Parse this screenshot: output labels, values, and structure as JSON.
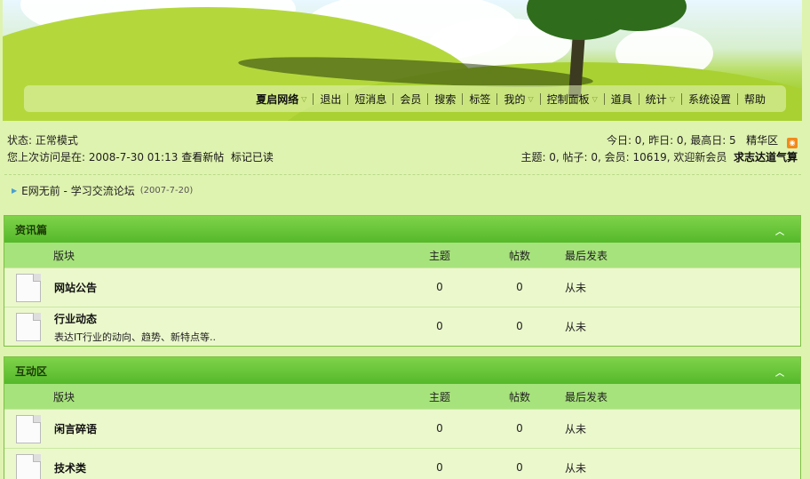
{
  "nav": {
    "items": [
      {
        "label": "夏启网络",
        "dropdown": true,
        "bold": true
      },
      {
        "label": "退出"
      },
      {
        "label": "短消息"
      },
      {
        "label": "会员"
      },
      {
        "label": "搜索"
      },
      {
        "label": "标签"
      },
      {
        "label": "我的",
        "dropdown": true
      },
      {
        "label": "控制面板",
        "dropdown": true
      },
      {
        "label": "道具"
      },
      {
        "label": "统计",
        "dropdown": true
      },
      {
        "label": "系统设置"
      },
      {
        "label": "帮助"
      }
    ]
  },
  "status": {
    "mode": "状态: 正常模式",
    "last_visit": "您上次访问是在: 2008-7-30 01:13",
    "view_new": "查看新帖",
    "mark_read": "标记已读",
    "today_stats": "今日: 0, 昨日: 0, 最高日: 5",
    "digest": "精华区",
    "rss_icon": "rss-icon",
    "forum_stats": "主题: 0, 帖子: 0, 会员: 10619, 欢迎新会员",
    "newest_member": "求志达道气算"
  },
  "announcement": {
    "text": "E网无前  - 学习交流论坛",
    "date": "(2007-7-20)"
  },
  "columns": {
    "forum": "版块",
    "topics": "主题",
    "posts": "帖数",
    "last_post": "最后发表"
  },
  "sections": [
    {
      "title": "资讯篇",
      "forums": [
        {
          "name": "网站公告",
          "desc": "",
          "topics": "0",
          "posts": "0",
          "last": "从未"
        },
        {
          "name": "行业动态",
          "desc": "表达IT行业的动向、趋势、新特点等..",
          "topics": "0",
          "posts": "0",
          "last": "从未"
        }
      ]
    },
    {
      "title": "互动区",
      "forums": [
        {
          "name": "闲言碎语",
          "desc": "",
          "topics": "0",
          "posts": "0",
          "last": "从未"
        },
        {
          "name": "技术类",
          "desc": "",
          "topics": "0",
          "posts": "0",
          "last": "从未"
        }
      ]
    }
  ]
}
